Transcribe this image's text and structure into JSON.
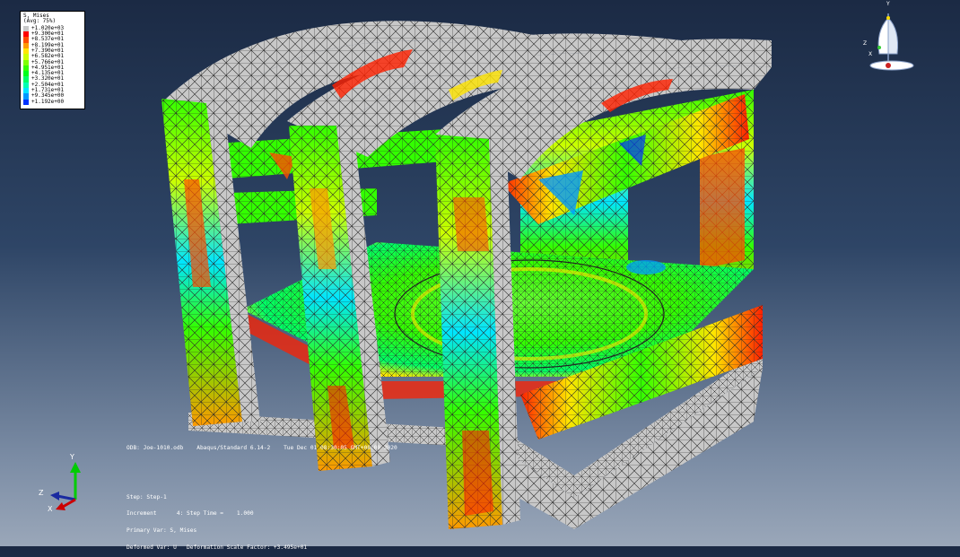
{
  "legend": {
    "title_line1": "S, Mises",
    "title_line2": "(Avg: 75%)",
    "entries": [
      {
        "label": "+1.020e+03",
        "color": "#c8c8c8"
      },
      {
        "label": "+9.300e+01",
        "color": "#ff0000"
      },
      {
        "label": "+8.537e+01",
        "color": "#ff4c00"
      },
      {
        "label": "+8.199e+01",
        "color": "#ff9900"
      },
      {
        "label": "+7.390e+01",
        "color": "#ffe500"
      },
      {
        "label": "+6.582e+01",
        "color": "#ccff00"
      },
      {
        "label": "+5.766e+01",
        "color": "#7fff00"
      },
      {
        "label": "+4.951e+01",
        "color": "#33ff00"
      },
      {
        "label": "+4.135e+01",
        "color": "#00ff19"
      },
      {
        "label": "+3.320e+01",
        "color": "#00ff66"
      },
      {
        "label": "+2.504e+01",
        "color": "#00ffb2"
      },
      {
        "label": "+1.731e+01",
        "color": "#00e5ff"
      },
      {
        "label": "+9.345e+00",
        "color": "#0099ff"
      },
      {
        "label": "+1.192e+00",
        "color": "#0033ff"
      }
    ]
  },
  "odb_line": "ODB: Joe-1010.odb    Abaqus/Standard 6.14-2    Tue Dec 01 08:30:05 GMT+08:00 2020",
  "step_info": {
    "line1": "Step: Step-1",
    "line2": "Increment      4: Step Time =    1.000",
    "line3": "Primary Var: S, Mises",
    "line4": "Deformed Var: U   Deformation Scale Factor: +3.495e+01"
  },
  "triad_bottom": {
    "x": "X",
    "y": "Y",
    "z": "Z"
  },
  "triad_top": {
    "x": "X",
    "y": "Y",
    "z": "Z"
  },
  "colors": {
    "mesh_grey": "#c8c8c8",
    "mesh_line": "#2a2a2a",
    "stress_green": "#33ff00",
    "stress_red": "#ff2000",
    "stress_yellow": "#ffe500",
    "stress_blue": "#0099ff"
  }
}
